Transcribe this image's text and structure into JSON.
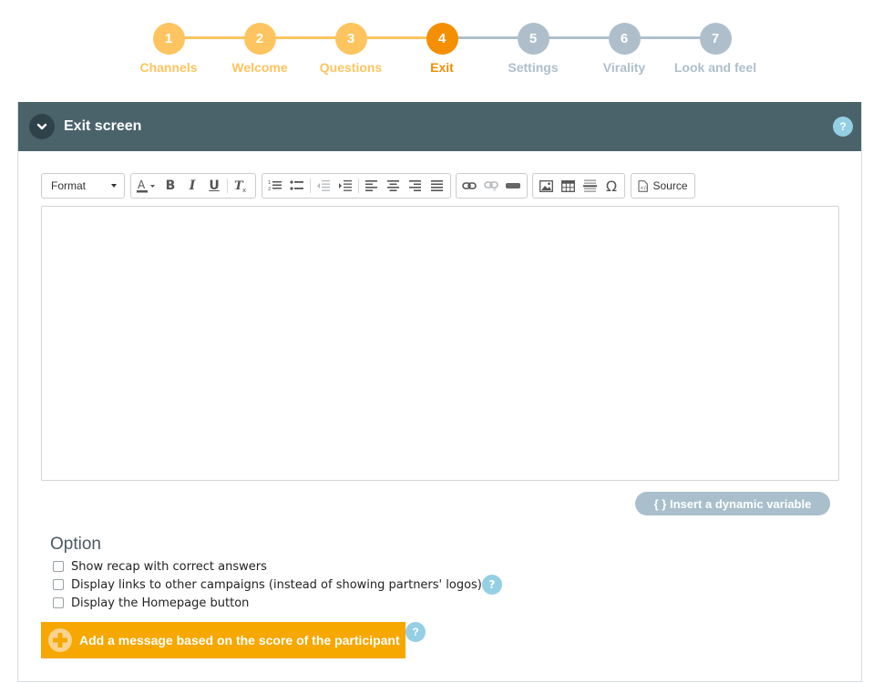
{
  "colors": {
    "done": "#fec45f",
    "active": "#f38f00",
    "todo": "#aebfcb",
    "header": "#4a636b",
    "help": "#94cfe4"
  },
  "stepper": {
    "steps": [
      {
        "number": "1",
        "label": "Channels",
        "state": "done"
      },
      {
        "number": "2",
        "label": "Welcome",
        "state": "done"
      },
      {
        "number": "3",
        "label": "Questions",
        "state": "done"
      },
      {
        "number": "4",
        "label": "Exit",
        "state": "active"
      },
      {
        "number": "5",
        "label": "Settings",
        "state": "todo"
      },
      {
        "number": "6",
        "label": "Virality",
        "state": "todo"
      },
      {
        "number": "7",
        "label": "Look and feel",
        "state": "todo"
      }
    ]
  },
  "panel": {
    "title": "Exit screen",
    "help": "?",
    "collapse_icon": "chevron-down-icon"
  },
  "toolbar": {
    "format_label": "Format",
    "bold": "B",
    "italic": "I",
    "underline": "U",
    "source_label": "Source"
  },
  "editor": {
    "content": ""
  },
  "dynamic_variable": {
    "label": "{ } Insert a dynamic variable"
  },
  "options": {
    "title": "Option",
    "items": [
      {
        "label": "Show recap with correct answers",
        "checked": false,
        "has_help": false
      },
      {
        "label": "Display links to other campaigns (instead of showing partners' logos)",
        "checked": false,
        "has_help": true
      },
      {
        "label": "Display the Homepage button",
        "checked": false,
        "has_help": false
      }
    ],
    "help": "?"
  },
  "score_button": {
    "label": "Add a message based on the score of the participant",
    "help": "?"
  }
}
